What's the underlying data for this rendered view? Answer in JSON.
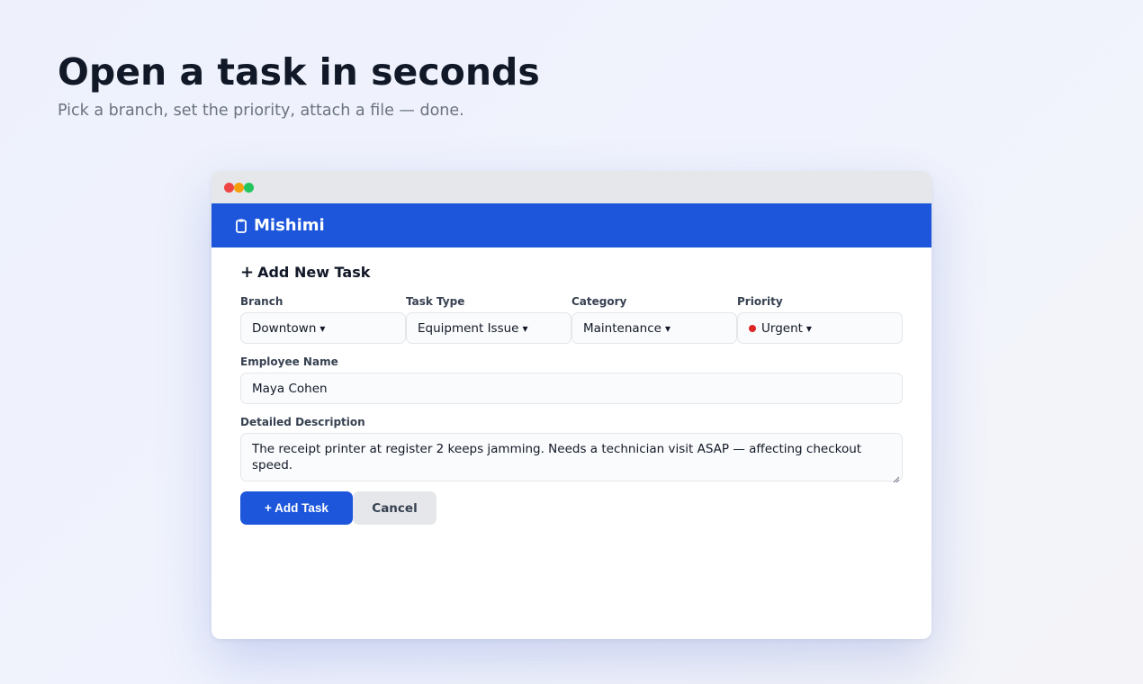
{
  "hero": {
    "title": "Open a task in seconds",
    "subtitle": "Pick a branch, set the priority, attach a file — done."
  },
  "app": {
    "name": "Mishimi",
    "logo_icon": "clipboard-icon",
    "accent_color": "#1d56db"
  },
  "form": {
    "title": "Add New Task",
    "fields": {
      "branch": {
        "label": "Branch",
        "value": "Downtown"
      },
      "task_type": {
        "label": "Task Type",
        "value": "Equipment Issue"
      },
      "category": {
        "label": "Category",
        "value": "Maintenance"
      },
      "priority": {
        "label": "Priority",
        "value": "Urgent",
        "color": "#dc2626"
      },
      "employee_name": {
        "label": "Employee Name",
        "value": "Maya Cohen"
      },
      "description": {
        "label": "Detailed Description",
        "value": "The receipt printer at register 2 keeps jamming. Needs a technician visit ASAP — affecting checkout speed."
      }
    },
    "actions": {
      "submit_label": "+ Add Task",
      "cancel_label": "Cancel"
    }
  }
}
